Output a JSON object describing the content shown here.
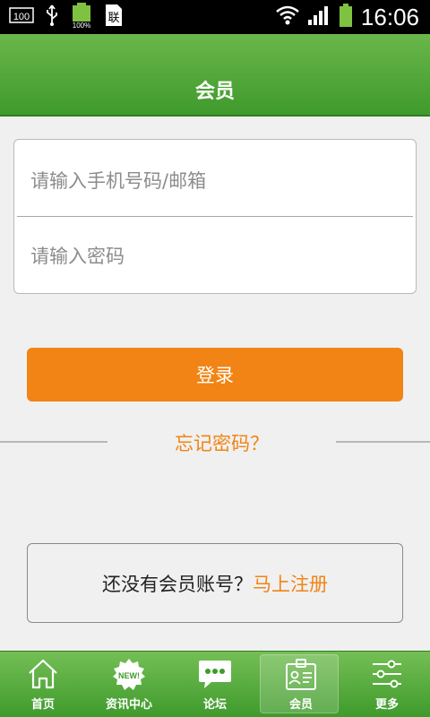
{
  "status_bar": {
    "time": "16:06",
    "left_icons": [
      "usb-debug-100-icon",
      "usb-icon",
      "battery-full-small-icon",
      "sim-card-icon"
    ],
    "battery_small_label": "100%",
    "badge_100": "100",
    "sim_label": "联",
    "right_icons": [
      "wifi-icon",
      "signal-icon",
      "battery-icon"
    ]
  },
  "header": {
    "title": "会员"
  },
  "login_form": {
    "phone_placeholder": "请输入手机号码/邮箱",
    "phone_value": "",
    "password_placeholder": "请输入密码",
    "password_value": ""
  },
  "login_button": {
    "label": "登录"
  },
  "forgot_password": {
    "label": "忘记密码？"
  },
  "register": {
    "prompt": "还没有会员账号？",
    "link": "马上注册"
  },
  "tabbar": {
    "tabs": [
      {
        "label": "首页",
        "icon": "home-icon",
        "active": false
      },
      {
        "label": "资讯中心",
        "icon": "news-badge-icon",
        "active": false
      },
      {
        "label": "论坛",
        "icon": "chat-bubble-icon",
        "active": false
      },
      {
        "label": "会员",
        "icon": "member-card-icon",
        "active": true
      },
      {
        "label": "更多",
        "icon": "sliders-icon",
        "active": false
      }
    ],
    "new_badge": "NEW!"
  },
  "colors": {
    "brand_green": "#4ea836",
    "accent_orange": "#f18414",
    "background": "#f0f0f0"
  }
}
